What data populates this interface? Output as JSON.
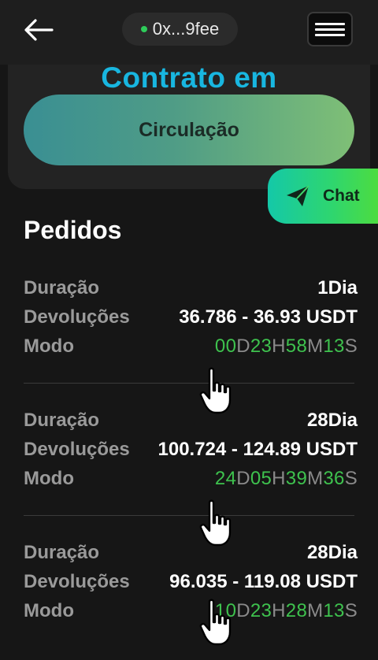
{
  "header": {
    "back_icon": "arrow-left-icon",
    "wallet_address": "0x...9fee",
    "wallet_status_color": "#2ecc5a",
    "menu_icon": "hamburger-icon"
  },
  "contract": {
    "title": "Contrato em",
    "status": "Circulação",
    "title_color": "#18b6e0"
  },
  "chat": {
    "label": "Chat",
    "icon": "paper-plane-icon"
  },
  "orders": {
    "title": "Pedidos",
    "duration_label": "Duração",
    "returns_label": "Devoluções",
    "mode_label": "Modo",
    "items": [
      {
        "duration": "1Dia",
        "returns": "36.786 - 36.93 USDT",
        "timer": {
          "d": "00",
          "h": "23",
          "m": "58",
          "s": "13"
        }
      },
      {
        "duration": "28Dia",
        "returns": "100.724 - 124.89 USDT",
        "timer": {
          "d": "24",
          "h": "05",
          "m": "39",
          "s": "36"
        }
      },
      {
        "duration": "28Dia",
        "returns": "96.035 - 119.08 USDT",
        "timer": {
          "d": "10",
          "h": "23",
          "m": "28",
          "s": "13"
        }
      }
    ]
  },
  "timer_units": {
    "d": "D",
    "h": "H",
    "m": "M",
    "s": "S"
  },
  "colors": {
    "accent_green": "#3ec24e",
    "background": "#161616"
  }
}
